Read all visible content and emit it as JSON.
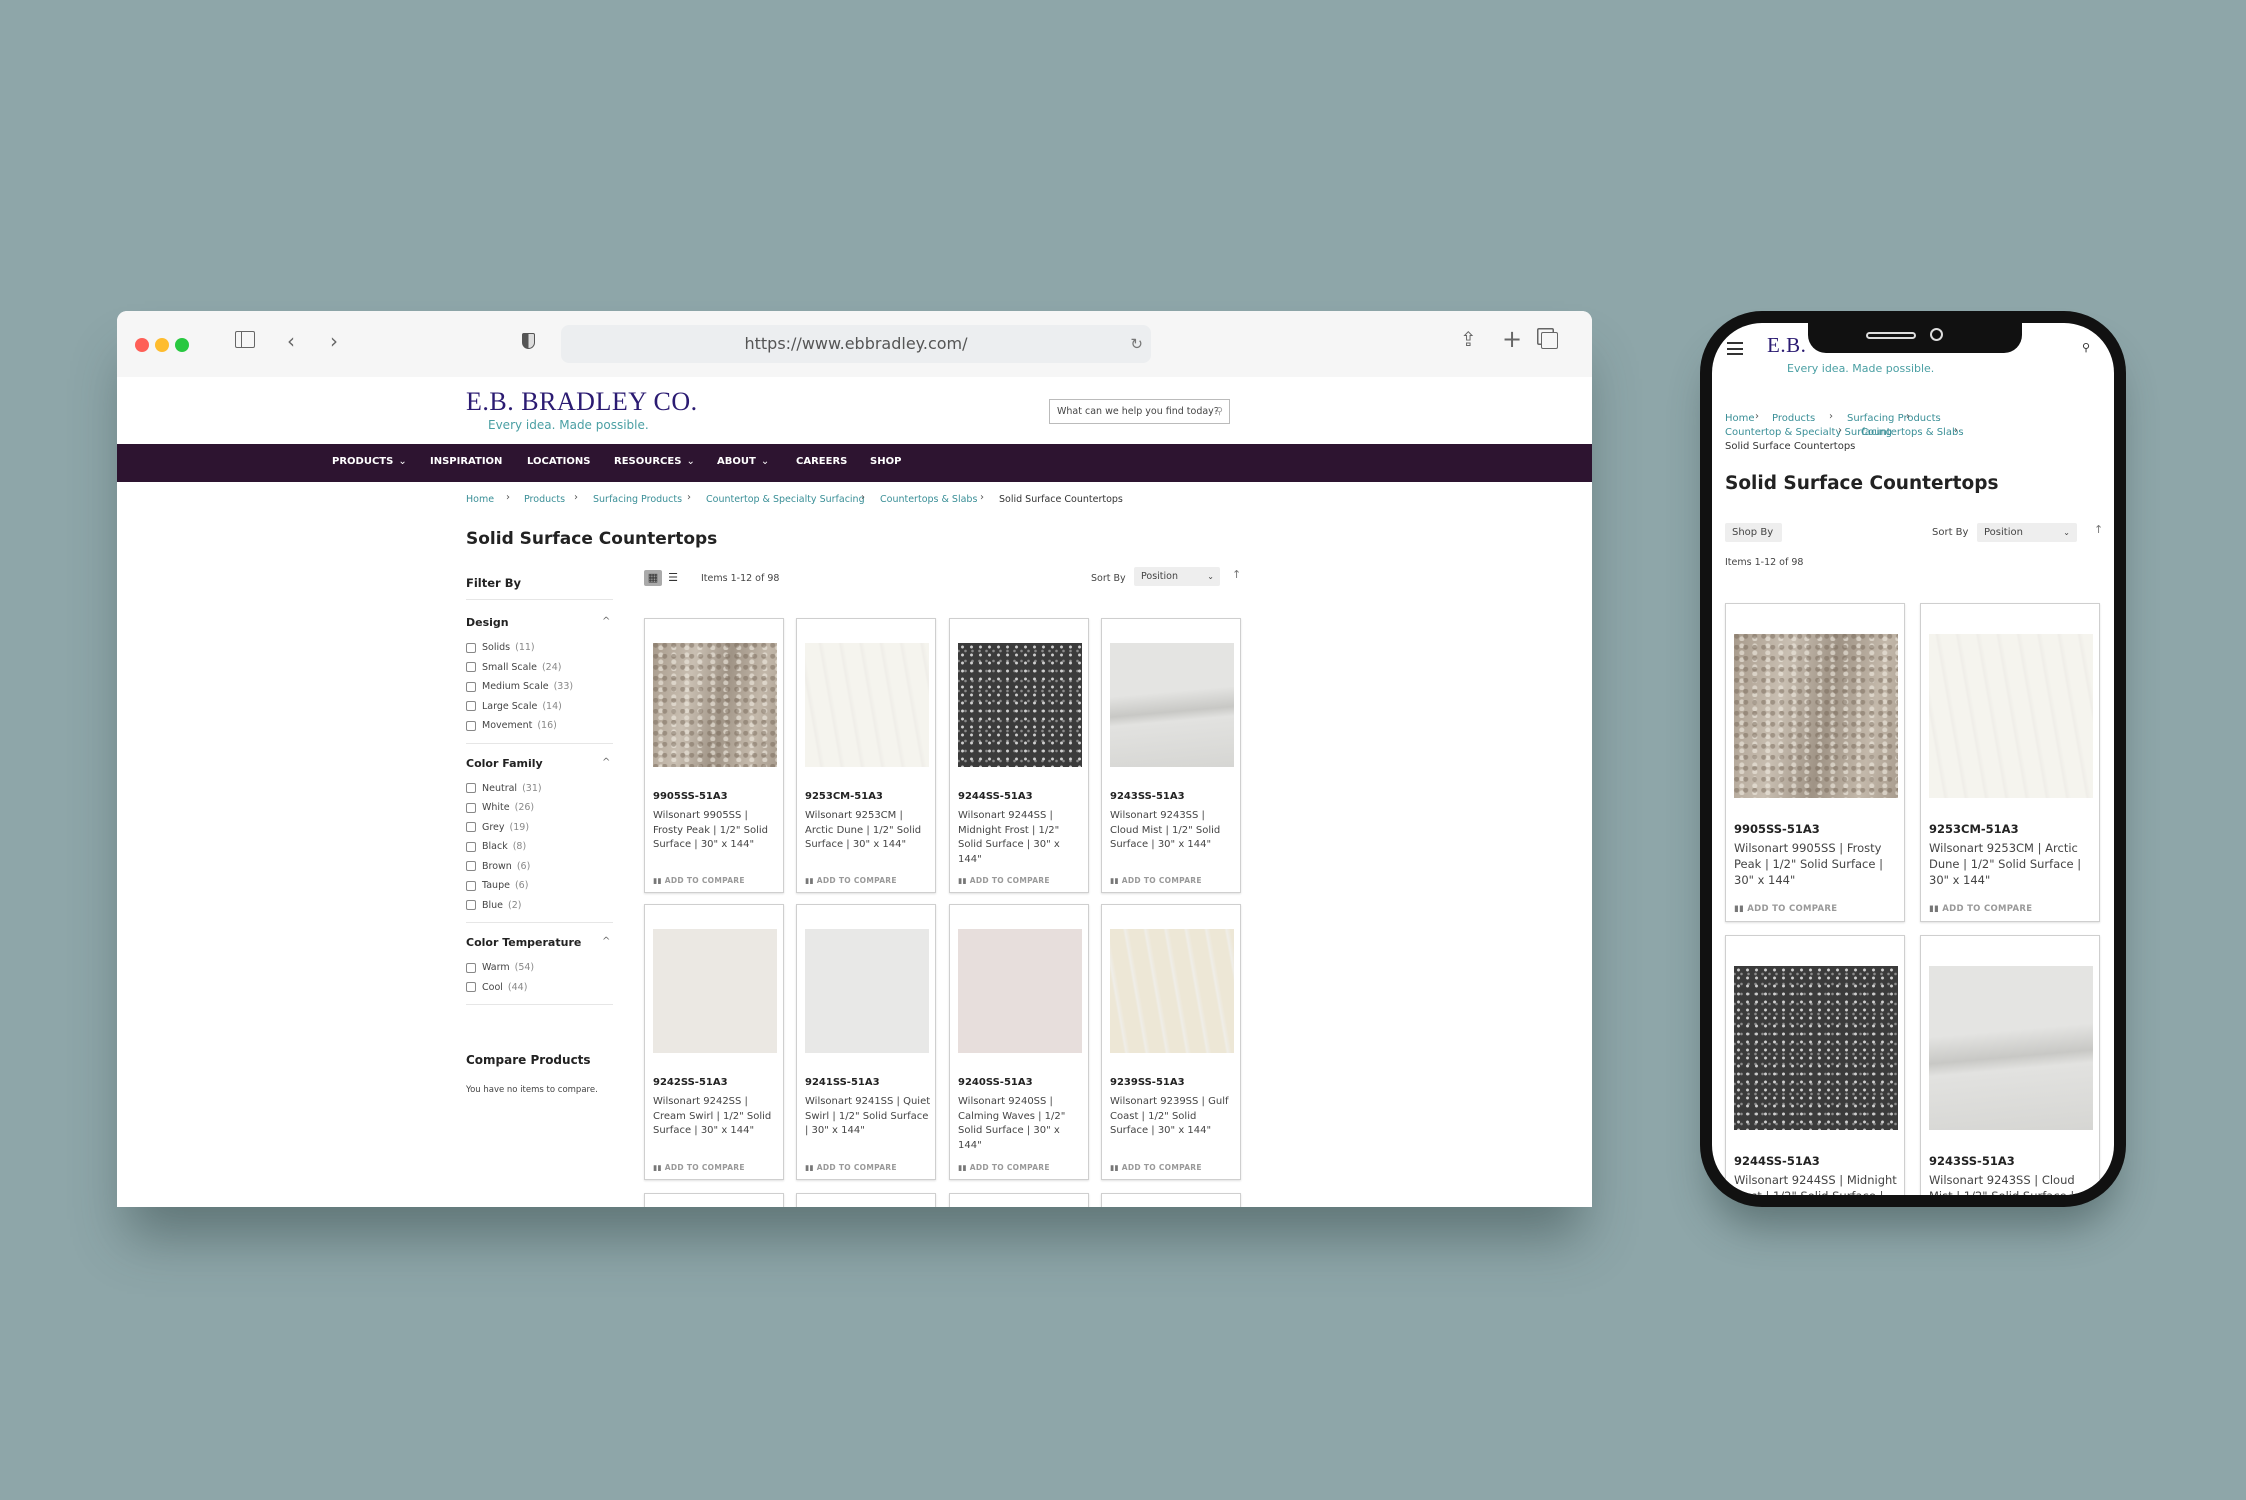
{
  "browser": {
    "url": "https://www.ebbradley.com/",
    "icons": [
      "close-dot",
      "minimize-dot",
      "maximize-dot",
      "sidebar-icon",
      "back-icon",
      "forward-icon",
      "shield-icon",
      "reload-icon",
      "share-icon",
      "new-tab-icon",
      "tabs-icon"
    ]
  },
  "site": {
    "logo": "E.B. BRADLEY CO.",
    "logo_short": "E.B.",
    "tagline": "Every idea. Made possible.",
    "search_placeholder": "What can we help you find today?",
    "colors": {
      "nav": "#2d1430",
      "logo": "#2b1b72",
      "link": "#3a8f97"
    }
  },
  "nav": [
    {
      "label": "PRODUCTS",
      "dropdown": true
    },
    {
      "label": "INSPIRATION",
      "dropdown": false
    },
    {
      "label": "LOCATIONS",
      "dropdown": false
    },
    {
      "label": "RESOURCES",
      "dropdown": true
    },
    {
      "label": "ABOUT",
      "dropdown": true
    },
    {
      "label": "CAREERS",
      "dropdown": false
    },
    {
      "label": "SHOP",
      "dropdown": false
    }
  ],
  "breadcrumb": [
    "Home",
    "Products",
    "Surfacing Products",
    "Countertop & Specialty Surfacing",
    "Countertops & Slabs",
    "Solid Surface Countertops"
  ],
  "page_title": "Solid Surface Countertops",
  "toolbar": {
    "items_count": "Items 1-12 of 98",
    "sort_label": "Sort By",
    "sort_value": "Position",
    "shop_by": "Shop By",
    "view_mode": "grid"
  },
  "filters": {
    "title": "Filter By",
    "groups": [
      {
        "title": "Design",
        "options": [
          {
            "label": "Solids",
            "count": "(11)"
          },
          {
            "label": "Small Scale",
            "count": "(24)"
          },
          {
            "label": "Medium Scale",
            "count": "(33)"
          },
          {
            "label": "Large Scale",
            "count": "(14)"
          },
          {
            "label": "Movement",
            "count": "(16)"
          }
        ]
      },
      {
        "title": "Color Family",
        "options": [
          {
            "label": "Neutral",
            "count": "(31)"
          },
          {
            "label": "White",
            "count": "(26)"
          },
          {
            "label": "Grey",
            "count": "(19)"
          },
          {
            "label": "Black",
            "count": "(8)"
          },
          {
            "label": "Brown",
            "count": "(6)"
          },
          {
            "label": "Taupe",
            "count": "(6)"
          },
          {
            "label": "Blue",
            "count": "(2)"
          }
        ]
      },
      {
        "title": "Color Temperature",
        "options": [
          {
            "label": "Warm",
            "count": "(54)"
          },
          {
            "label": "Cool",
            "count": "(44)"
          }
        ]
      }
    ]
  },
  "compare": {
    "title": "Compare Products",
    "empty": "You have no items to compare."
  },
  "add_to_compare": "ADD TO COMPARE",
  "products": [
    {
      "sku": "9905SS-51A3",
      "name": "Wilsonart 9905SS | Frosty Peak | 1/2\" Solid Surface | 30\" x 144\"",
      "swatch": "#b4aa9d",
      "texture": "granite"
    },
    {
      "sku": "9253CM-51A3",
      "name": "Wilsonart 9253CM | Arctic Dune | 1/2\" Solid Surface | 30\" x 144\"",
      "swatch": "#f5f4ee",
      "texture": "streak"
    },
    {
      "sku": "9244SS-51A3",
      "name": "Wilsonart 9244SS | Midnight Frost | 1/2\" Solid Surface | 30\" x 144\"",
      "swatch": "#3b3b3b",
      "texture": "speckle"
    },
    {
      "sku": "9243SS-51A3",
      "name": "Wilsonart 9243SS | Cloud Mist | 1/2\" Solid Surface | 30\" x 144\"",
      "swatch": "#d9d9d7",
      "texture": "veined"
    },
    {
      "sku": "9242SS-51A3",
      "name": "Wilsonart 9242SS | Cream Swirl | 1/2\" Solid Surface | 30\" x 144\"",
      "swatch": "#ebe8e3",
      "texture": "plain"
    },
    {
      "sku": "9241SS-51A3",
      "name": "Wilsonart 9241SS | Quiet Swirl | 1/2\" Solid Surface | 30\" x 144\"",
      "swatch": "#e8e8e7",
      "texture": "plain"
    },
    {
      "sku": "9240SS-51A3",
      "name": "Wilsonart 9240SS | Calming Waves | 1/2\" Solid Surface | 30\" x 144\"",
      "swatch": "#e7dedc",
      "texture": "plain"
    },
    {
      "sku": "9239SS-51A3",
      "name": "Wilsonart 9239SS | Gulf Coast | 1/2\" Solid Surface | 30\" x 144\"",
      "swatch": "#ede7d6",
      "texture": "streak"
    }
  ],
  "phone_products_visible": [
    0,
    1,
    2,
    3
  ]
}
